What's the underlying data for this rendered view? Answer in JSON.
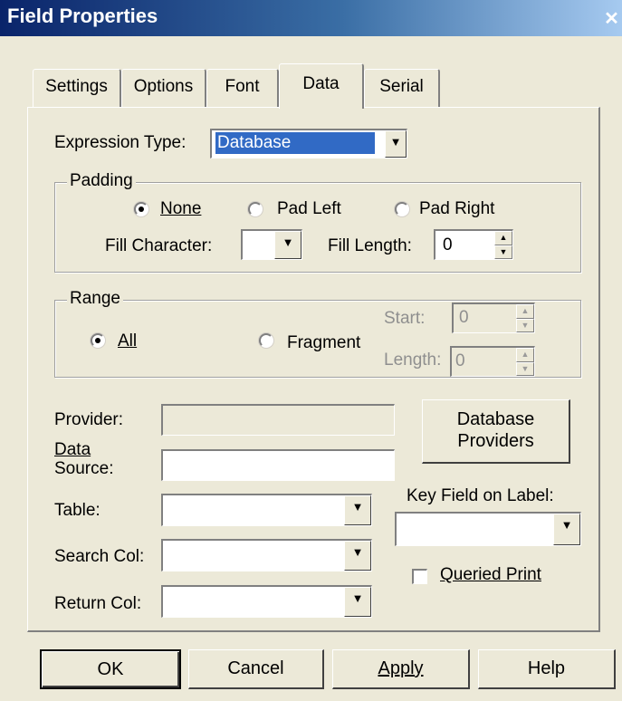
{
  "window": {
    "title": "Field Properties",
    "close_glyph": "✕"
  },
  "tabs": [
    {
      "label": "Settings",
      "active": false
    },
    {
      "label": "Options",
      "active": false
    },
    {
      "label": "Font",
      "active": false
    },
    {
      "label": "Data",
      "active": true
    },
    {
      "label": "Serial",
      "active": false
    }
  ],
  "expression": {
    "label": "Expression Type:",
    "value": "Database"
  },
  "padding": {
    "group_label": "Padding",
    "options": [
      {
        "label": "None",
        "checked": true
      },
      {
        "label": "Pad Left",
        "checked": false
      },
      {
        "label": "Pad Right",
        "checked": false
      }
    ],
    "fill_character_label": "Fill Character:",
    "fill_character_value": "",
    "fill_length_label": "Fill Length:",
    "fill_length_value": "0"
  },
  "range": {
    "group_label": "Range",
    "options": [
      {
        "label": "All",
        "checked": true
      },
      {
        "label": "Fragment",
        "checked": false
      }
    ],
    "start_label": "Start:",
    "start_value": "0",
    "length_label": "Length:",
    "length_value": "0"
  },
  "data_source": {
    "provider_label": "Provider:",
    "provider_value": "",
    "data_source_label_1": "Data",
    "data_source_label_2": "Source:",
    "data_source_value": "",
    "table_label": "Table:",
    "table_value": "",
    "search_col_label": "Search Col:",
    "search_col_value": "",
    "return_col_label": "Return Col:",
    "return_col_value": "",
    "db_providers_button_1": "Database",
    "db_providers_button_2": "Providers",
    "key_field_label": "Key Field on Label:",
    "key_field_value": "",
    "queried_print_label": "Queried Print",
    "queried_print_checked": false
  },
  "buttons": {
    "ok": "OK",
    "cancel": "Cancel",
    "apply": "Apply",
    "help": "Help"
  },
  "icons": {
    "dropdown": "▼",
    "spin_up": "▲",
    "spin_down": "▼"
  },
  "colors": {
    "title_bar": "#0a246a",
    "selection": "#316ac5",
    "dialog_bg": "#ece9d8"
  }
}
